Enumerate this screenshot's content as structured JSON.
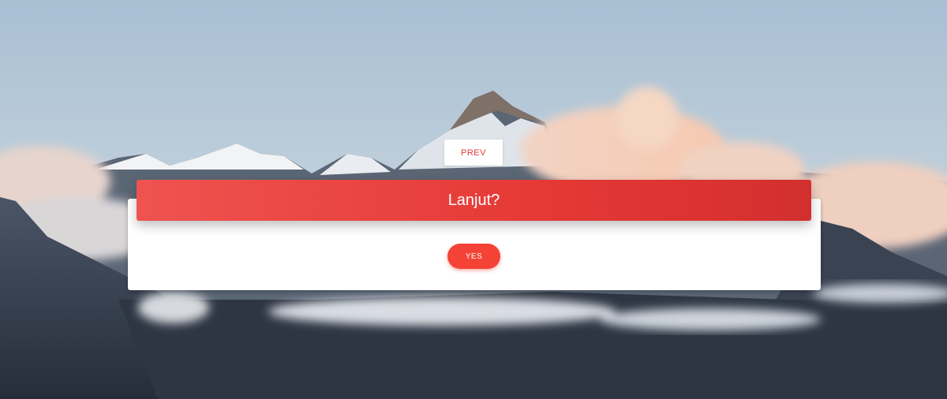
{
  "navigation": {
    "prev_label": "PREV"
  },
  "dialog": {
    "title": "Lanjut?",
    "yes_label": "YES"
  },
  "colors": {
    "accent": "#e53935",
    "button": "#f44336",
    "sky": "#b3c8da"
  },
  "background": {
    "image": "mountain-landscape"
  }
}
